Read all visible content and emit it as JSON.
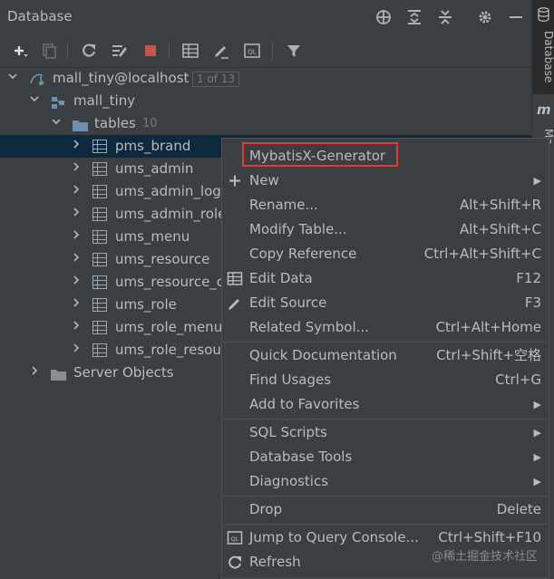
{
  "panel": {
    "title": "Database",
    "header_icons": [
      "crosshair-icon",
      "expand-all-icon",
      "collapse-all-icon",
      "gear-icon",
      "minimize-icon"
    ],
    "toolbar_icons": [
      "add-icon",
      "duplicate-icon",
      "refresh-icon",
      "properties-icon",
      "stop-icon",
      "table-icon",
      "edit-icon",
      "query-console-icon",
      "filter-icon"
    ]
  },
  "right_strip": {
    "database_tab": "Database",
    "mybatis_tab": "Ma",
    "mybatis_icon": "m"
  },
  "tree": {
    "connection": {
      "label": "mall_tiny@localhost",
      "badge": "1 of 13"
    },
    "schema": {
      "label": "mall_tiny"
    },
    "tables_folder": {
      "label": "tables",
      "count": "10"
    },
    "tables": [
      "pms_brand",
      "ums_admin",
      "ums_admin_logi",
      "ums_admin_role",
      "ums_menu",
      "ums_resource",
      "ums_resource_c",
      "ums_role",
      "ums_role_menu",
      "ums_role_resour"
    ],
    "selected_table": "pms_brand",
    "server_objects": {
      "label": "Server Objects"
    }
  },
  "context_menu": {
    "items": [
      {
        "label": "MybatisX-Generator",
        "shortcut": "",
        "icon": "",
        "submenu": false
      },
      {
        "label": "New",
        "shortcut": "",
        "icon": "plus-icon",
        "submenu": true
      },
      {
        "label": "Rename...",
        "shortcut": "Alt+Shift+R",
        "icon": "",
        "submenu": false
      },
      {
        "label": "Modify Table...",
        "shortcut": "Alt+Shift+C",
        "icon": "",
        "submenu": false
      },
      {
        "label": "Copy Reference",
        "shortcut": "Ctrl+Alt+Shift+C",
        "icon": "",
        "submenu": false
      },
      {
        "label": "Edit Data",
        "shortcut": "F12",
        "icon": "table-icon",
        "submenu": false
      },
      {
        "label": "Edit Source",
        "shortcut": "F3",
        "icon": "pencil-icon",
        "submenu": false
      },
      {
        "label": "Related Symbol...",
        "shortcut": "Ctrl+Alt+Home",
        "icon": "",
        "submenu": false
      },
      {
        "label": "Quick Documentation",
        "shortcut": "Ctrl+Shift+空格",
        "icon": "",
        "submenu": false
      },
      {
        "label": "Find Usages",
        "shortcut": "Ctrl+G",
        "icon": "",
        "submenu": false
      },
      {
        "label": "Add to Favorites",
        "shortcut": "",
        "icon": "",
        "submenu": true
      },
      {
        "label": "SQL Scripts",
        "shortcut": "",
        "icon": "",
        "submenu": true
      },
      {
        "label": "Database Tools",
        "shortcut": "",
        "icon": "",
        "submenu": true
      },
      {
        "label": "Diagnostics",
        "shortcut": "",
        "icon": "",
        "submenu": true
      },
      {
        "label": "Drop",
        "shortcut": "Delete",
        "icon": "",
        "submenu": false
      },
      {
        "label": "Jump to Query Console...",
        "shortcut": "Ctrl+Shift+F10",
        "icon": "query-console-icon",
        "submenu": false
      },
      {
        "label": "Refresh",
        "shortcut": "",
        "icon": "refresh-icon",
        "submenu": false
      }
    ]
  },
  "watermark": "@稀土掘金技术社区",
  "colors": {
    "background": "#3c3f41",
    "selection": "#0d293e",
    "highlight_box": "#e53935",
    "folder": "#6e8faf"
  }
}
